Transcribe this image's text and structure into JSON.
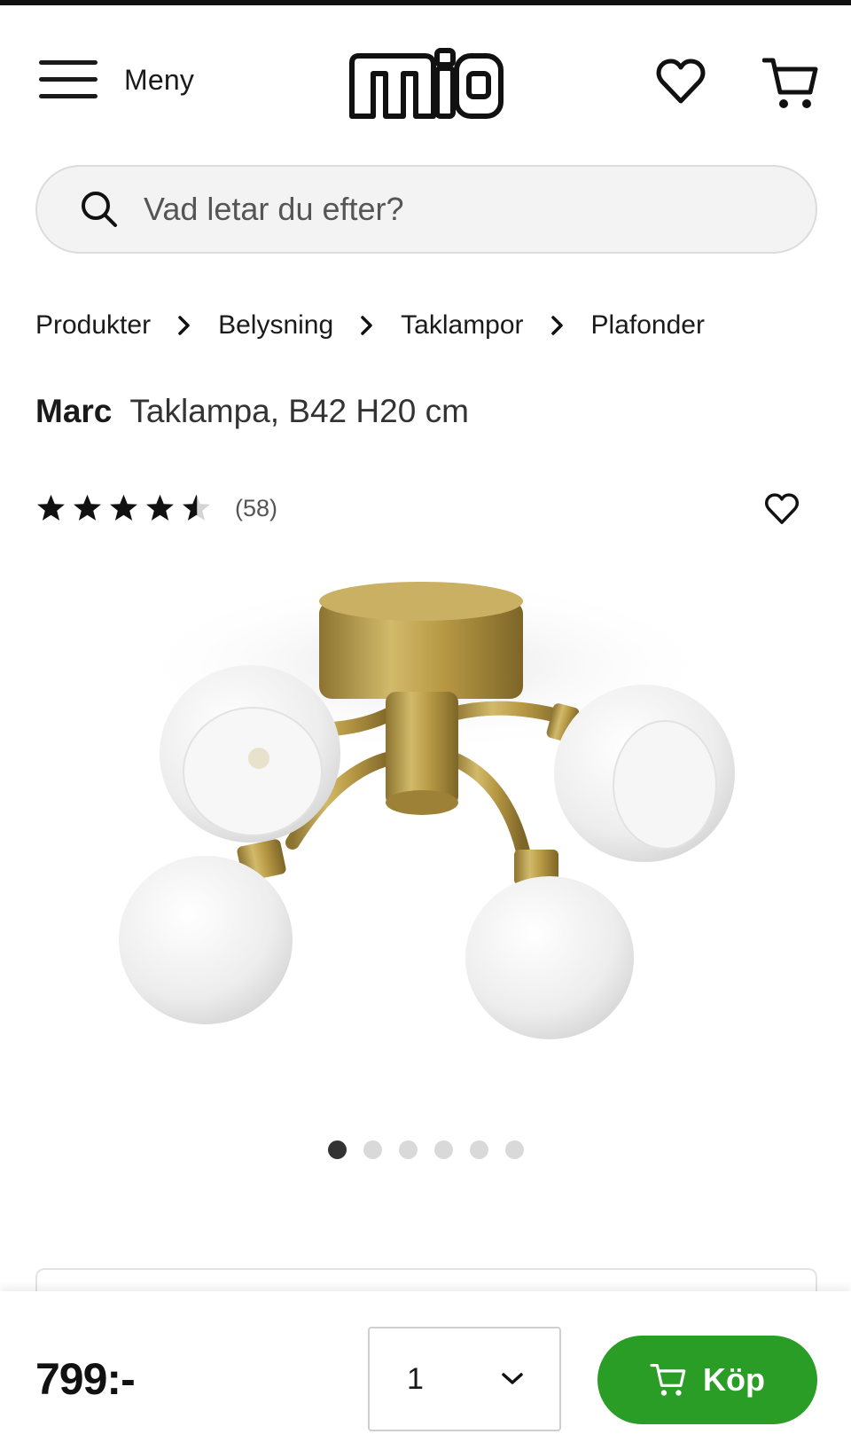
{
  "header": {
    "menu_label": "Meny",
    "logo_text": "mio"
  },
  "search": {
    "placeholder": "Vad letar du efter?"
  },
  "breadcrumb": [
    "Produkter",
    "Belysning",
    "Taklampor",
    "Plafonder"
  ],
  "product": {
    "brand": "Marc",
    "name": "Taklampa, B42 H20 cm",
    "rating": 4.5,
    "review_count": "(58)"
  },
  "carousel": {
    "image_count": 6,
    "active_index": 0
  },
  "buybar": {
    "price": "799:-",
    "quantity": "1",
    "buy_label": "Köp"
  },
  "colors": {
    "accent": "#2a9d26",
    "text": "#1a1a1a",
    "brass": "#b89a45"
  }
}
